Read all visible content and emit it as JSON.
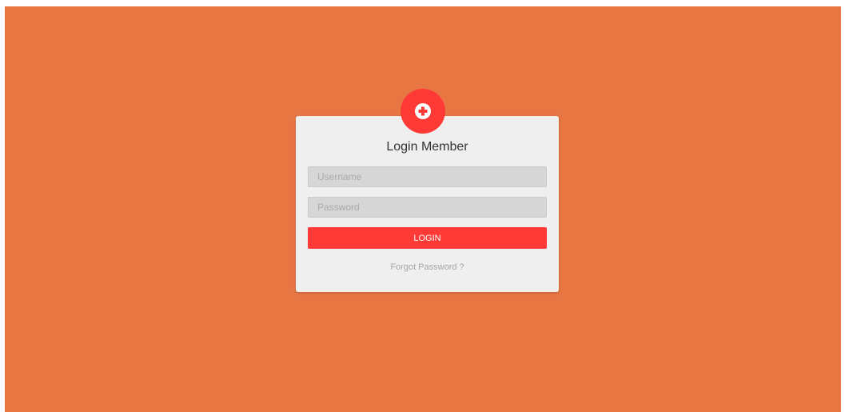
{
  "colors": {
    "background": "#e77643",
    "card": "#efefef",
    "accent": "#ff3935",
    "input_bg": "#d6d6d6"
  },
  "logo": {
    "icon": "plus-circle-icon"
  },
  "login": {
    "title": "Login Member",
    "username_placeholder": "Username",
    "password_placeholder": "Password",
    "button_label": "LOGIN",
    "forgot_label": "Forgot Password ?"
  }
}
